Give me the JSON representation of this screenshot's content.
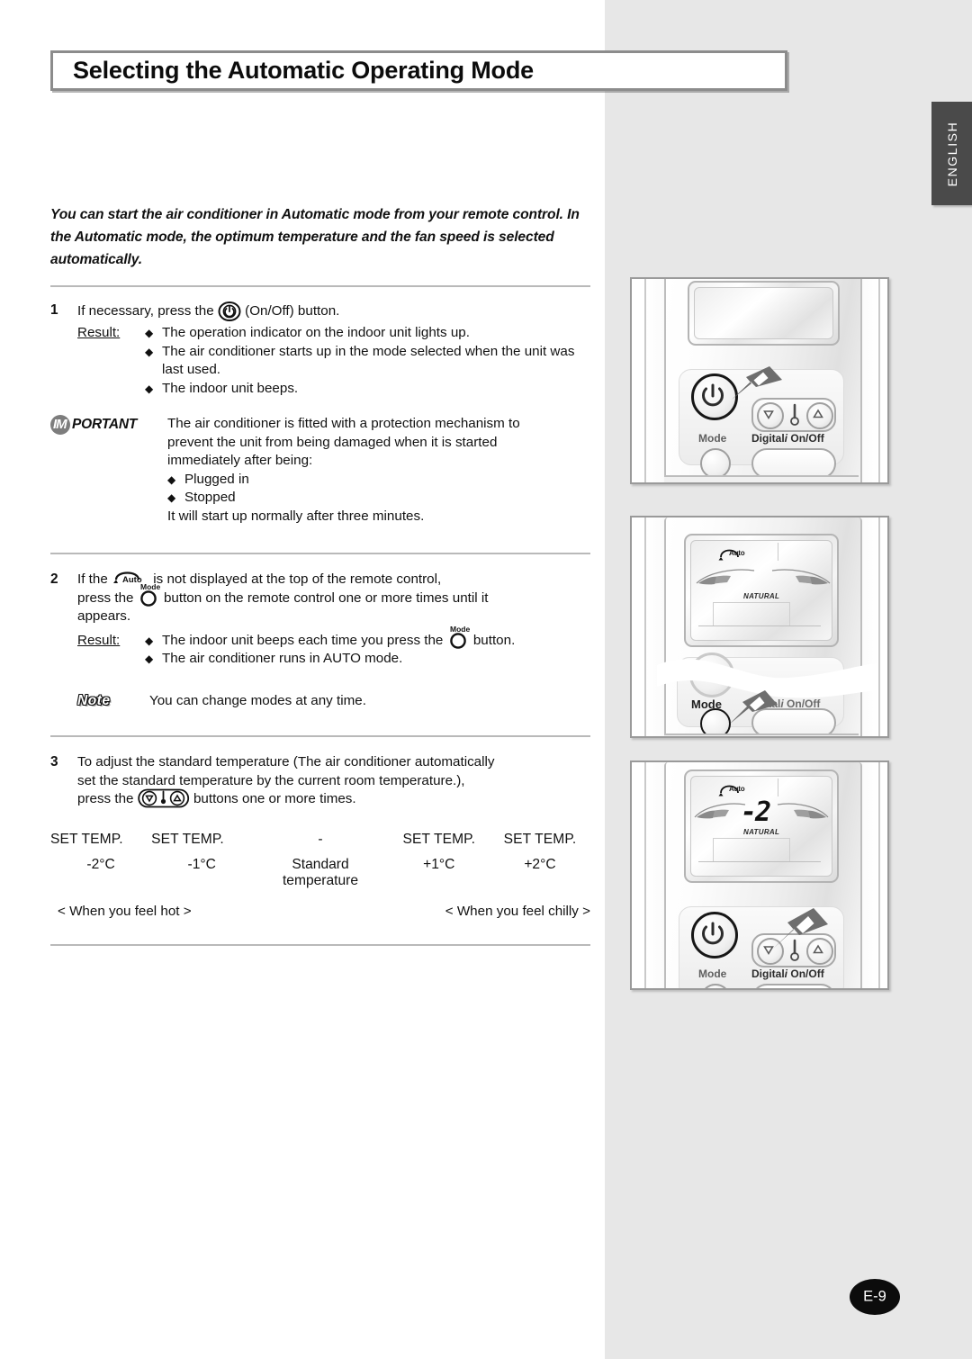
{
  "page": {
    "title": "Selecting the Automatic Operating Mode",
    "language_tab": "ENGLISH",
    "page_number": "E-9"
  },
  "intro": "You can start the air conditioner in Automatic mode from your remote control. In the Automatic mode, the optimum temperature and the fan speed is selected automatically.",
  "steps": [
    {
      "number": "1",
      "text_before_icon": "If necessary, press the",
      "icon": "power-icon",
      "text_after_icon": "(On/Off) button.",
      "result_label": "Result:",
      "results": [
        "The operation indicator on the indoor unit lights up.",
        "The air conditioner starts up in the mode selected when the unit was last used.",
        "The indoor unit beeps."
      ]
    },
    {
      "number": "2",
      "line1_a": "If the",
      "line1_icon": "auto-indicator-icon",
      "line1_b": "is not displayed at the top of the remote control,",
      "line2_a": "press the",
      "line2_icon": "mode-button-icon",
      "line2_b": "button on the remote control one or more times until it",
      "line3": "appears.",
      "result_label": "Result:",
      "results": [
        {
          "a": "The indoor unit beeps each time you press the",
          "icon": "mode-button-icon",
          "b": "button."
        },
        {
          "a": "The air conditioner runs in AUTO mode.",
          "icon": "",
          "b": ""
        }
      ],
      "note_label": "Note",
      "note_text": "You can change modes at any time."
    },
    {
      "number": "3",
      "line1": "To adjust the standard temperature (The air conditioner automatically",
      "line2": "set the standard temperature by the current room temperature.),",
      "line3_a": "press the",
      "line3_icon": "temp-updown-icon",
      "line3_b": "buttons one or more times."
    }
  ],
  "important": {
    "tag_prefix": "IM",
    "tag_rest": "PORTANT",
    "body_lines": [
      "The air conditioner is fitted with a protection mechanism to",
      "prevent the unit from being damaged when it is started",
      "immediately after being:"
    ],
    "bullets": [
      "Plugged in",
      "Stopped"
    ],
    "closing": "It will start up normally after three minutes."
  },
  "temperature_scale": {
    "header_row": [
      "SET TEMP.",
      "SET TEMP.",
      "-",
      "SET TEMP.",
      "SET TEMP."
    ],
    "value_row": [
      "-2°C",
      "-1°C",
      "Standard temperature",
      "+1°C",
      "+2°C"
    ],
    "caption_left": "< When you feel hot >",
    "caption_right": "< When you feel chilly >"
  },
  "illustrations": {
    "panel1": {
      "name": "remote-power-button-illustration",
      "labels": {
        "mode": "Mode",
        "digital": "Digital",
        "digital_i": "i",
        "onoff": "On/Off"
      }
    },
    "panel2": {
      "name": "remote-mode-button-illustration",
      "display": {
        "auto": "Auto",
        "natural": "NATURAL"
      },
      "labels": {
        "mode": "Mode",
        "digital_partial": "ital",
        "digital_i": "i",
        "onoff": "On/Off"
      }
    },
    "panel3": {
      "name": "remote-temp-buttons-illustration",
      "display": {
        "auto": "Auto",
        "natural": "NATURAL",
        "temp": "-2"
      },
      "labels": {
        "mode": "Mode",
        "digital": "Digital",
        "digital_i": "i",
        "onoff": "On/Off"
      }
    }
  },
  "colors": {
    "gray_band": "#e7e7e7",
    "tab_bg": "#4a4a4a",
    "rule": "#b9b9b9",
    "cursor": "#6e6e6e"
  }
}
